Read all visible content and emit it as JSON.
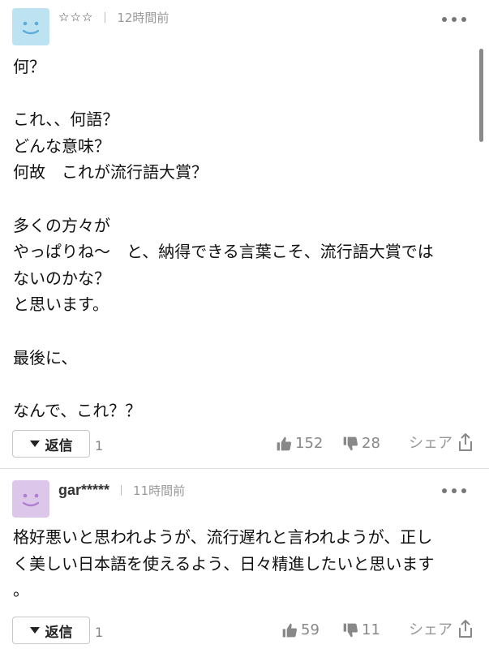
{
  "comments": [
    {
      "stars": "☆☆☆",
      "time": "12時間前",
      "body": "何？\n\nこれ、、何語？\nどんな意味？\n何故　これが流行語大賞？\n\n多くの方々が\nやっぱりね〜　と、納得できる言葉こそ、流行語大賞では\nないのかな？\nと思います。\n\n最後に、\n\nなんで、これ？？",
      "reply_label": "返信",
      "reply_count": "1",
      "likes": "152",
      "dislikes": "28",
      "share_label": "シェア"
    },
    {
      "username": "gar*****",
      "time": "11時間前",
      "body": "格好悪いと思われようが、流行遅れと言われようが、正し\nく美しい日本語を使えるよう、日々精進したいと思います\n。",
      "reply_label": "返信",
      "reply_count": "1",
      "likes": "59",
      "dislikes": "11",
      "share_label": "シェア"
    }
  ],
  "colors": {
    "avatar1": "#bde3f2",
    "avatar2": "#dcc7ea",
    "face1": "#5aaed8",
    "face2": "#b07ed0",
    "icon_gray": "#888888"
  },
  "icons": [
    "avatar-smiley-icon",
    "more-dots-icon",
    "triangle-down-icon",
    "thumbs-up-icon",
    "thumbs-down-icon",
    "share-icon"
  ]
}
